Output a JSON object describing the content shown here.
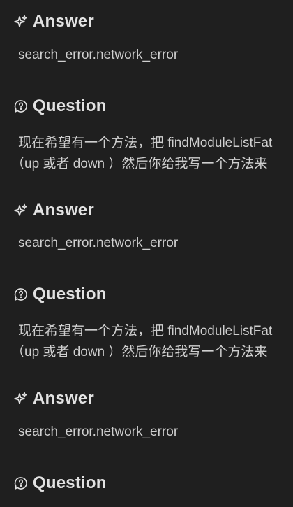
{
  "entries": [
    {
      "type": "answer",
      "heading": "Answer",
      "text": "search_error.network_error"
    },
    {
      "type": "question",
      "heading": "Question",
      "line1": "现在希望有一个方法，把 findModuleListFat",
      "line2": "（up 或者 down ）然后你给我写一个方法来"
    },
    {
      "type": "answer",
      "heading": "Answer",
      "text": "search_error.network_error"
    },
    {
      "type": "question",
      "heading": "Question",
      "line1": "现在希望有一个方法，把 findModuleListFat",
      "line2": "（up 或者 down ）然后你给我写一个方法来"
    },
    {
      "type": "answer",
      "heading": "Answer",
      "text": "search_error.network_error"
    },
    {
      "type": "question",
      "heading": "Question"
    }
  ],
  "icons": {
    "answer": "sparkle-icon",
    "question": "chat-question-icon"
  },
  "colors": {
    "background": "#1f1f1f",
    "heading": "#e2e2e2",
    "body_text": "#cfcfcf"
  }
}
